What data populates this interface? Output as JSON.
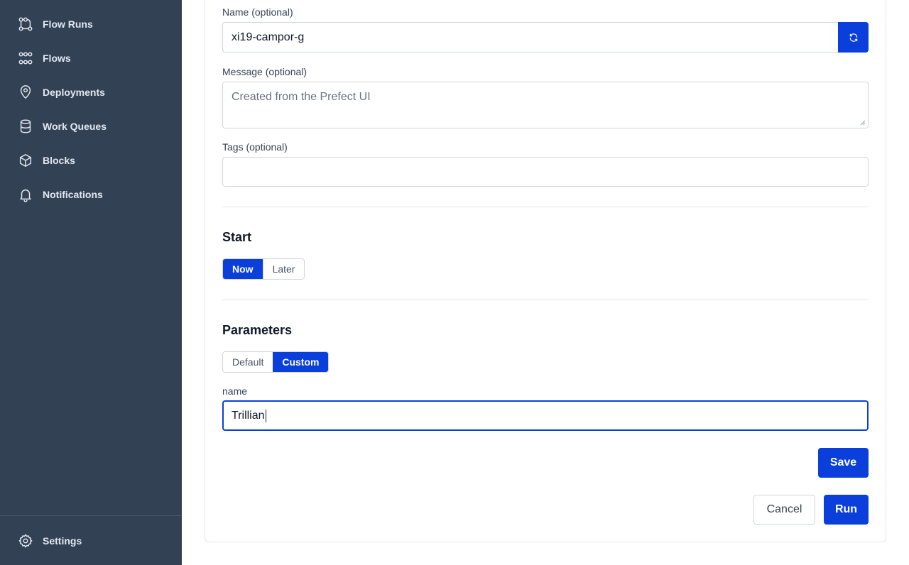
{
  "sidebar": {
    "items": [
      {
        "label": "Flow Runs",
        "icon": "flow-runs-icon"
      },
      {
        "label": "Flows",
        "icon": "flows-icon"
      },
      {
        "label": "Deployments",
        "icon": "location-pin-icon"
      },
      {
        "label": "Work Queues",
        "icon": "database-icon"
      },
      {
        "label": "Blocks",
        "icon": "cube-icon"
      },
      {
        "label": "Notifications",
        "icon": "bell-icon"
      }
    ],
    "settings": {
      "label": "Settings",
      "icon": "gear-icon"
    }
  },
  "form": {
    "name": {
      "label": "Name (optional)",
      "value": "xi19-campor-g"
    },
    "message": {
      "label": "Message (optional)",
      "value": "Created from the Prefect UI"
    },
    "tags": {
      "label": "Tags (optional)",
      "value": ""
    },
    "start": {
      "title": "Start",
      "options": [
        "Now",
        "Later"
      ],
      "selected": "Now"
    },
    "parameters": {
      "title": "Parameters",
      "options": [
        "Default",
        "Custom"
      ],
      "selected": "Custom",
      "fields": [
        {
          "label": "name",
          "value": "Trillian"
        }
      ]
    },
    "save_label": "Save",
    "cancel_label": "Cancel",
    "run_label": "Run"
  },
  "colors": {
    "sidebar_bg": "#334155",
    "accent": "#0b3fdc"
  }
}
